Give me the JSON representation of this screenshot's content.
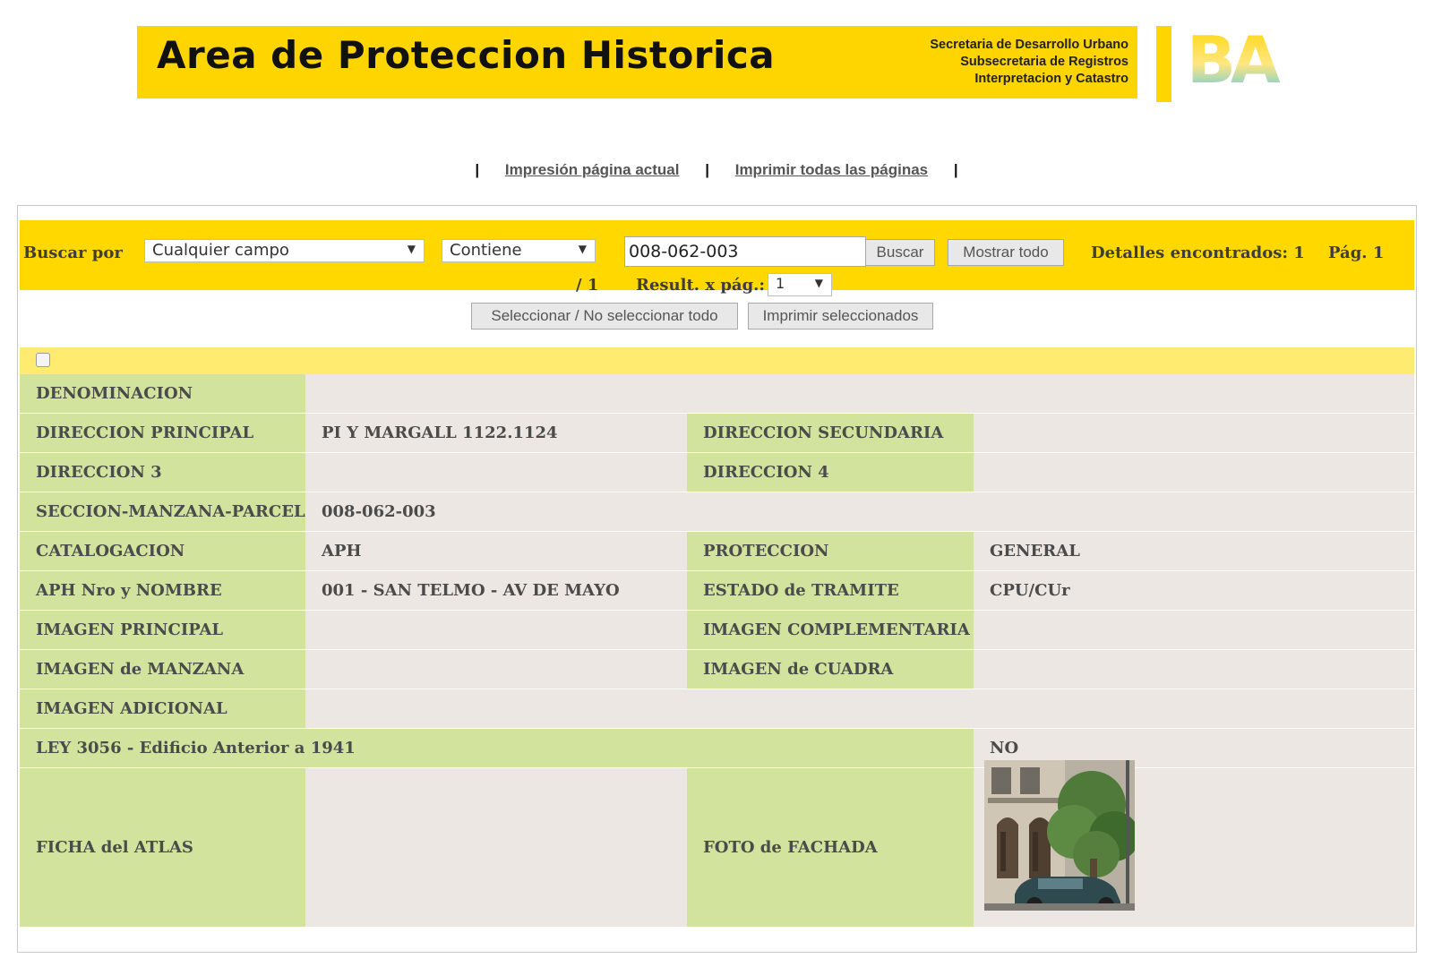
{
  "header": {
    "title": "Area de Proteccion Historica",
    "subtitle_lines": [
      "Secretaria de Desarrollo Urbano",
      "Subsecretaria de Registros",
      "Interpretacion y Catastro"
    ],
    "logo_text": "BA",
    "brand_color": "#ffd500"
  },
  "print_links": {
    "current_page": "Impresión página actual",
    "all_pages": "Imprimir todas las páginas",
    "separator": "|"
  },
  "search": {
    "label": "Buscar por",
    "field_select": "Cualquier campo",
    "operator_select": "Contiene",
    "query_value": "008-062-003",
    "search_button": "Buscar",
    "show_all_button": "Mostrar todo",
    "found_text": "Detalles encontrados: 1",
    "page_text": "Pág. 1",
    "page_total": "/ 1",
    "per_page_label": "Result. x pág.:",
    "per_page_value": "1"
  },
  "actions": {
    "select_toggle": "Seleccionar / No seleccionar todo",
    "print_selected": "Imprimir seleccionados"
  },
  "details": {
    "denominacion_label": "DENOMINACION",
    "denominacion_value": "",
    "direccion_principal_label": "DIRECCION PRINCIPAL",
    "direccion_principal_value": "PI Y MARGALL 1122.1124",
    "direccion_secundaria_label": "DIRECCION SECUNDARIA",
    "direccion_secundaria_value": "",
    "direccion3_label": "DIRECCION 3",
    "direccion3_value": "",
    "direccion4_label": "DIRECCION 4",
    "direccion4_value": "",
    "smp_label": "SECCION-MANZANA-PARCELA",
    "smp_value": "008-062-003",
    "catalogacion_label": "CATALOGACION",
    "catalogacion_value": "APH",
    "proteccion_label": "PROTECCION",
    "proteccion_value": "GENERAL",
    "aph_label": "APH Nro y NOMBRE",
    "aph_value": "001 - SAN TELMO - AV DE MAYO",
    "estado_label": "ESTADO de TRAMITE",
    "estado_value": "CPU/CUr",
    "img_principal_label": "IMAGEN PRINCIPAL",
    "img_complementaria_label": "IMAGEN COMPLEMENTARIA",
    "img_manzana_label": "IMAGEN de MANZANA",
    "img_cuadra_label": "IMAGEN de CUADRA",
    "img_adicional_label": "IMAGEN ADICIONAL",
    "ley_label": "LEY 3056 - Edificio Anterior a 1941",
    "ley_value": "NO",
    "ficha_label": "FICHA del ATLAS",
    "foto_label": "FOTO de FACHADA"
  },
  "colors": {
    "label_green": "#d1e39c",
    "value_gray": "#ece7e3",
    "search_yellow": "#ffd800",
    "checkbox_row_yellow": "#ffeb70"
  }
}
